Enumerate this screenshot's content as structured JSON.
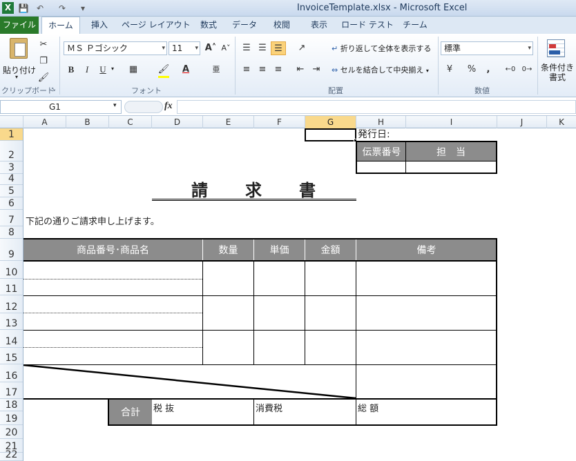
{
  "app": {
    "window_title": "InvoiceTemplate.xlsx - Microsoft Excel"
  },
  "tabs": [
    "ファイル",
    "ホーム",
    "挿入",
    "ページ レイアウト",
    "数式",
    "データ",
    "校閲",
    "表示",
    "ロード テスト",
    "チーム"
  ],
  "ribbon": {
    "clipboard": {
      "paste_label": "貼り付け",
      "group_label": "クリップボード"
    },
    "font": {
      "font_name": "ＭＳ Ｐゴシック",
      "font_size": "11",
      "group_label": "フォント",
      "bold": "B",
      "italic": "I",
      "underline": "U"
    },
    "alignment": {
      "wrap_text": "折り返して全体を表示する",
      "merge_center": "セルを結合して中央揃え",
      "group_label": "配置"
    },
    "number": {
      "format": "標準",
      "percent": "%",
      "comma": ",",
      "group_label": "数値"
    },
    "styles": {
      "conditional_label": "条件付き書式"
    }
  },
  "formula_bar": {
    "name_box": "G1",
    "fx": "fx",
    "formula": ""
  },
  "columns": [
    "A",
    "B",
    "C",
    "D",
    "E",
    "F",
    "G",
    "H",
    "I",
    "J",
    "K"
  ],
  "selected_column": "G",
  "rows": [
    "1",
    "2",
    "3",
    "4",
    "5",
    "6",
    "7",
    "8",
    "9",
    "10",
    "11",
    "12",
    "13",
    "14",
    "15",
    "16",
    "17",
    "18",
    "19",
    "20",
    "21",
    "22"
  ],
  "selected_row": "1",
  "sheet": {
    "issue_date_label": "発行日:",
    "slip_number_label": "伝票番号",
    "person_in_charge_label": "担　当",
    "title": "請　　求　　書",
    "intro": "下記の通りご請求申し上げます。",
    "table_headers": {
      "item": "商品番号･商品名",
      "quantity": "数量",
      "unit_price": "単価",
      "amount": "金額",
      "remarks": "備考"
    },
    "totals": {
      "total_label": "合計",
      "pretax_label": "税 抜",
      "tax_label": "消費税",
      "grand_total_label": "総 額"
    }
  }
}
